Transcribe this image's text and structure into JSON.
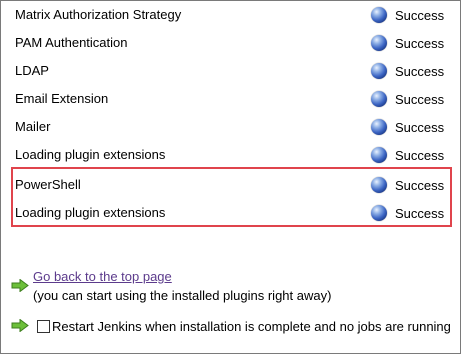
{
  "plugins": [
    {
      "name": "Matrix Authorization Strategy",
      "status": "Success"
    },
    {
      "name": "PAM Authentication",
      "status": "Success"
    },
    {
      "name": "LDAP",
      "status": "Success"
    },
    {
      "name": "Email Extension",
      "status": "Success"
    },
    {
      "name": "Mailer",
      "status": "Success"
    },
    {
      "name": "Loading plugin extensions",
      "status": "Success"
    },
    {
      "name": "PowerShell",
      "status": "Success"
    },
    {
      "name": "Loading plugin extensions",
      "status": "Success"
    }
  ],
  "footer": {
    "back_link": "Go back to the top page",
    "back_note": "(you can start using the installed plugins right away)",
    "restart_label": "Restart Jenkins when installation is complete and no jobs are running",
    "restart_checked": false
  },
  "colors": {
    "highlight": "#e0444c",
    "link": "#5c3b8c",
    "status_ball": "#3d66c4",
    "arrow": "#5aa02c"
  },
  "icons": {
    "status": "blue-ball-icon",
    "arrow": "green-arrow-icon"
  }
}
